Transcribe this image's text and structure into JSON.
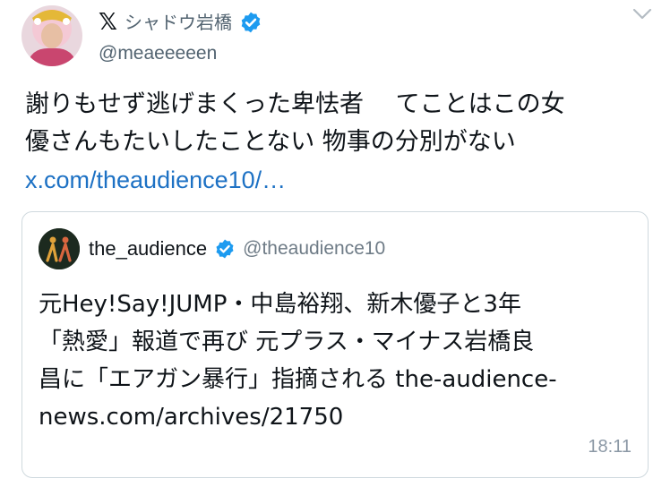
{
  "author": {
    "display_name": "シャドウ岩橋",
    "handle": "@meaeeeeen",
    "platform_icon": "x-logo",
    "verified_icon": "verified-badge-icon",
    "avatar_icon": "user-avatar"
  },
  "tweet": {
    "lines": [
      "謝りもせず逃げまくった卑怯者　 てことはこの女",
      "優さんもたいしたことない 物事の分別がない"
    ],
    "link": "x.com/theaudience10/…"
  },
  "quote": {
    "name": "the_audience",
    "handle": "@theaudience10",
    "verified_icon": "verified-badge-icon",
    "lines": [
      "元Hey!Say!JUMP・中島裕翔、新木優子と3年",
      "「熱愛」報道で再び 元プラス・マイナス岩橋良",
      "昌に「エアガン暴行」指摘される the-audience-",
      "news.com/archives/21750"
    ],
    "time": "18:11"
  },
  "colors": {
    "link": "#1d71c4",
    "verified": "#1d9bf0",
    "secondary_text": "#536471",
    "border": "#cfd9de"
  }
}
